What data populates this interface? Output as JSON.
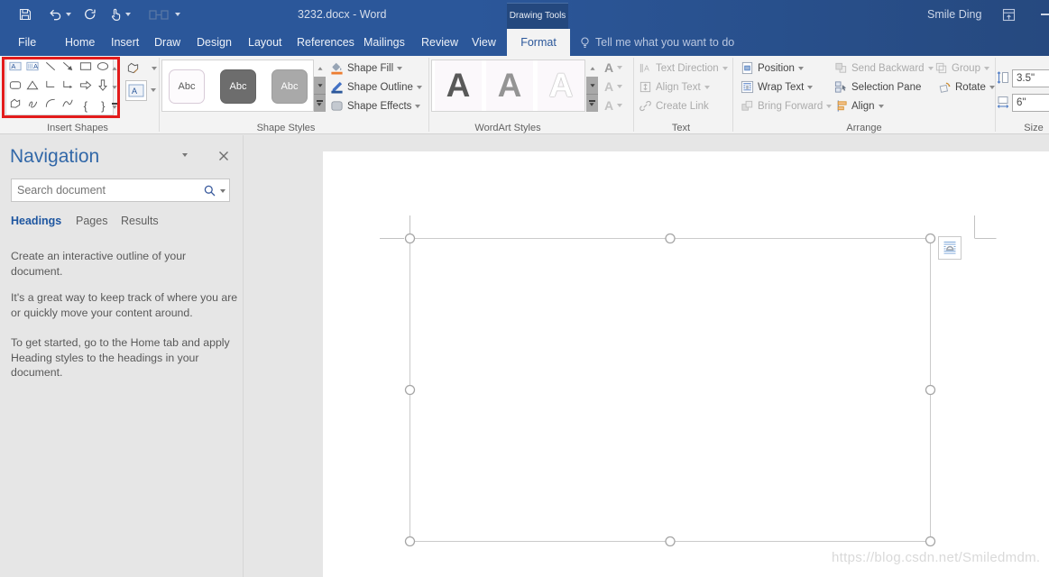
{
  "titlebar": {
    "title": "3232.docx - Word",
    "user": "Smile Ding",
    "contextual_group": "Drawing Tools"
  },
  "tabs": {
    "items": [
      "File",
      "Home",
      "Insert",
      "Draw",
      "Design",
      "Layout",
      "References",
      "Mailings",
      "Review",
      "View"
    ],
    "active": "Format"
  },
  "tellme": "Tell me what you want to do",
  "ribbon": {
    "insert_shapes": {
      "label": "Insert Shapes",
      "icons": [
        "text-box",
        "vertical-text-box",
        "line",
        "arrow",
        "rectangle",
        "oval",
        "rounded-rectangle",
        "triangle",
        "elbow-connector",
        "elbow-arrow-connector",
        "right-arrow",
        "down-arrow",
        "freeform",
        "scribble",
        "arc",
        "curve",
        "left-brace",
        "right-brace"
      ],
      "left_brace": "{",
      "right_brace": "}"
    },
    "shape_styles": {
      "label": "Shape Styles",
      "thumbnails": [
        "Abc",
        "Abc",
        "Abc"
      ],
      "fill": "Shape Fill",
      "outline": "Shape Outline",
      "effects": "Shape Effects"
    },
    "wordart": {
      "label": "WordArt Styles",
      "thumbnails": [
        "A",
        "A",
        "A"
      ],
      "buttons": [
        "A",
        "A",
        "A"
      ]
    },
    "text_group": {
      "label": "Text",
      "direction": "Text Direction",
      "align": "Align Text",
      "link": "Create Link"
    },
    "arrange": {
      "label": "Arrange",
      "position": "Position",
      "wrap": "Wrap Text",
      "bring_forward": "Bring Forward",
      "send_backward": "Send Backward",
      "selection_pane": "Selection Pane",
      "align": "Align",
      "group": "Group",
      "rotate": "Rotate"
    },
    "size": {
      "label": "Size",
      "height": "3.5\"",
      "width": "6\""
    }
  },
  "navigation": {
    "title": "Navigation",
    "search_placeholder": "Search document",
    "tabs": [
      "Headings",
      "Pages",
      "Results"
    ],
    "active_tab": "Headings",
    "paragraphs": [
      [
        "Create an interactive outline of your",
        "document."
      ],
      [
        "It's a great way to keep track of where you are",
        "or quickly move your content around."
      ],
      [
        "To get started, go to the Home tab and apply",
        "Heading styles to the headings in your",
        "document."
      ]
    ]
  },
  "watermark": "https://blog.csdn.net/Smiledmdm."
}
